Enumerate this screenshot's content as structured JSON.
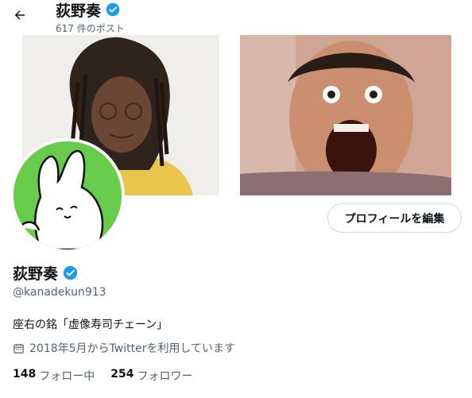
{
  "header": {
    "title": "荻野奏",
    "post_count": "617 件のポスト"
  },
  "profile": {
    "name": "荻野奏",
    "handle": "@kanadekun913",
    "bio": "座右の銘「虚像寿司チェーン」",
    "joined": "2018年5月からTwitterを利用しています",
    "edit_button": "プロフィールを編集",
    "following_count": "148",
    "following_label": "フォロー中",
    "followers_count": "254",
    "followers_label": "フォロワー"
  },
  "icons": {
    "back": "arrow-left-icon",
    "verified": "verified-badge-icon",
    "calendar": "calendar-icon"
  },
  "colors": {
    "verified": "#1d9bf0",
    "avatar_bg": "#66cc4a",
    "secondary_text": "#536471"
  }
}
